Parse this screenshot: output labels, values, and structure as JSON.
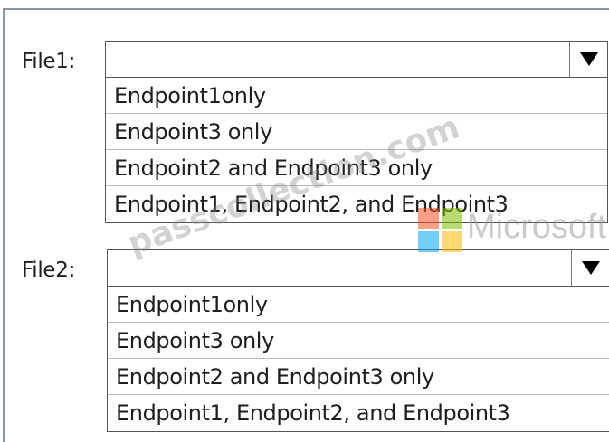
{
  "groups": [
    {
      "label": "File1:",
      "options": [
        "Endpoint1only",
        "Endpoint3 only",
        "Endpoint2 and Endpoint3 only",
        "Endpoint1, Endpoint2, and Endpoint3"
      ]
    },
    {
      "label": "File2:",
      "options": [
        "Endpoint1only",
        "Endpoint3 only",
        "Endpoint2 and Endpoint3 only",
        "Endpoint1, Endpoint2, and Endpoint3"
      ]
    }
  ],
  "watermark": {
    "site": "passcollection.com",
    "brand": "Microsoft",
    "logo_colors": [
      "#f25022",
      "#7fba00",
      "#00a4ef",
      "#ffb900"
    ]
  }
}
